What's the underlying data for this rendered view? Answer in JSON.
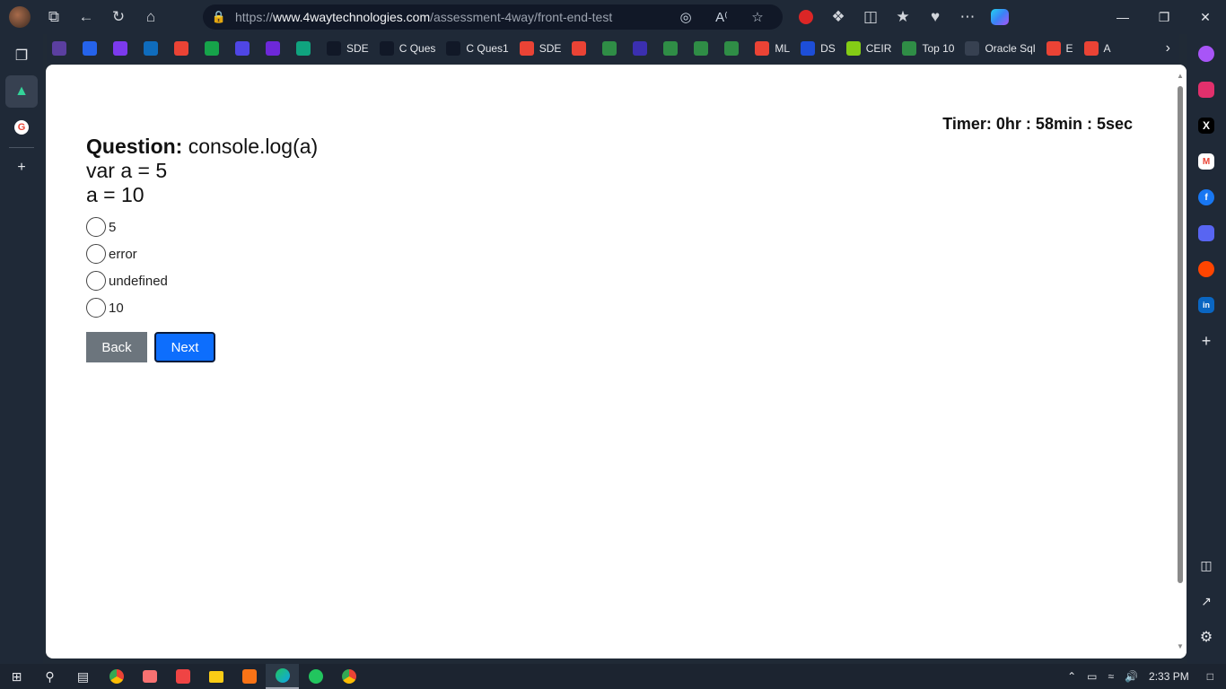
{
  "browser": {
    "url_prefix": "https://",
    "url_host": "www.4waytechnologies.com",
    "url_path": "/assessment-4way/front-end-test"
  },
  "bookmarks": [
    {
      "label": "",
      "color": "#5b3fa0"
    },
    {
      "label": "",
      "color": "#2563eb"
    },
    {
      "label": "",
      "color": "#7c3aed"
    },
    {
      "label": "",
      "color": "#0f6cbd"
    },
    {
      "label": "",
      "color": "#ea4335"
    },
    {
      "label": "",
      "color": "#16a34a"
    },
    {
      "label": "",
      "color": "#4f46e5"
    },
    {
      "label": "",
      "color": "#6d28d9"
    },
    {
      "label": "",
      "color": "#10a37f"
    },
    {
      "label": "SDE",
      "color": "#111827"
    },
    {
      "label": "C Ques",
      "color": "#111827"
    },
    {
      "label": "C Ques1",
      "color": "#111827"
    },
    {
      "label": "SDE",
      "color": "#ea4335"
    },
    {
      "label": "",
      "color": "#ea4335"
    },
    {
      "label": "",
      "color": "#2f8d46"
    },
    {
      "label": "",
      "color": "#3b2fb0"
    },
    {
      "label": "",
      "color": "#2f8d46"
    },
    {
      "label": "",
      "color": "#2f8d46"
    },
    {
      "label": "",
      "color": "#2f8d46"
    },
    {
      "label": "ML",
      "color": "#ea4335"
    },
    {
      "label": "DS",
      "color": "#1d4ed8"
    },
    {
      "label": "CEIR",
      "color": "#84cc16"
    },
    {
      "label": "Top 10",
      "color": "#2f8d46"
    },
    {
      "label": "Oracle Sql",
      "color": "#374151"
    },
    {
      "label": "E",
      "color": "#ea4335"
    },
    {
      "label": "A",
      "color": "#ea4335"
    }
  ],
  "page": {
    "timer": "Timer: 0hr : 58min : 5sec",
    "question_label": "Question:",
    "question_line1": " console.log(a)",
    "question_line2": "var a = 5",
    "question_line3": "a = 10",
    "options": [
      "5",
      "error",
      "undefined",
      "10"
    ],
    "back_label": "Back",
    "next_label": "Next"
  },
  "taskbar": {
    "time": "2:33 PM"
  }
}
